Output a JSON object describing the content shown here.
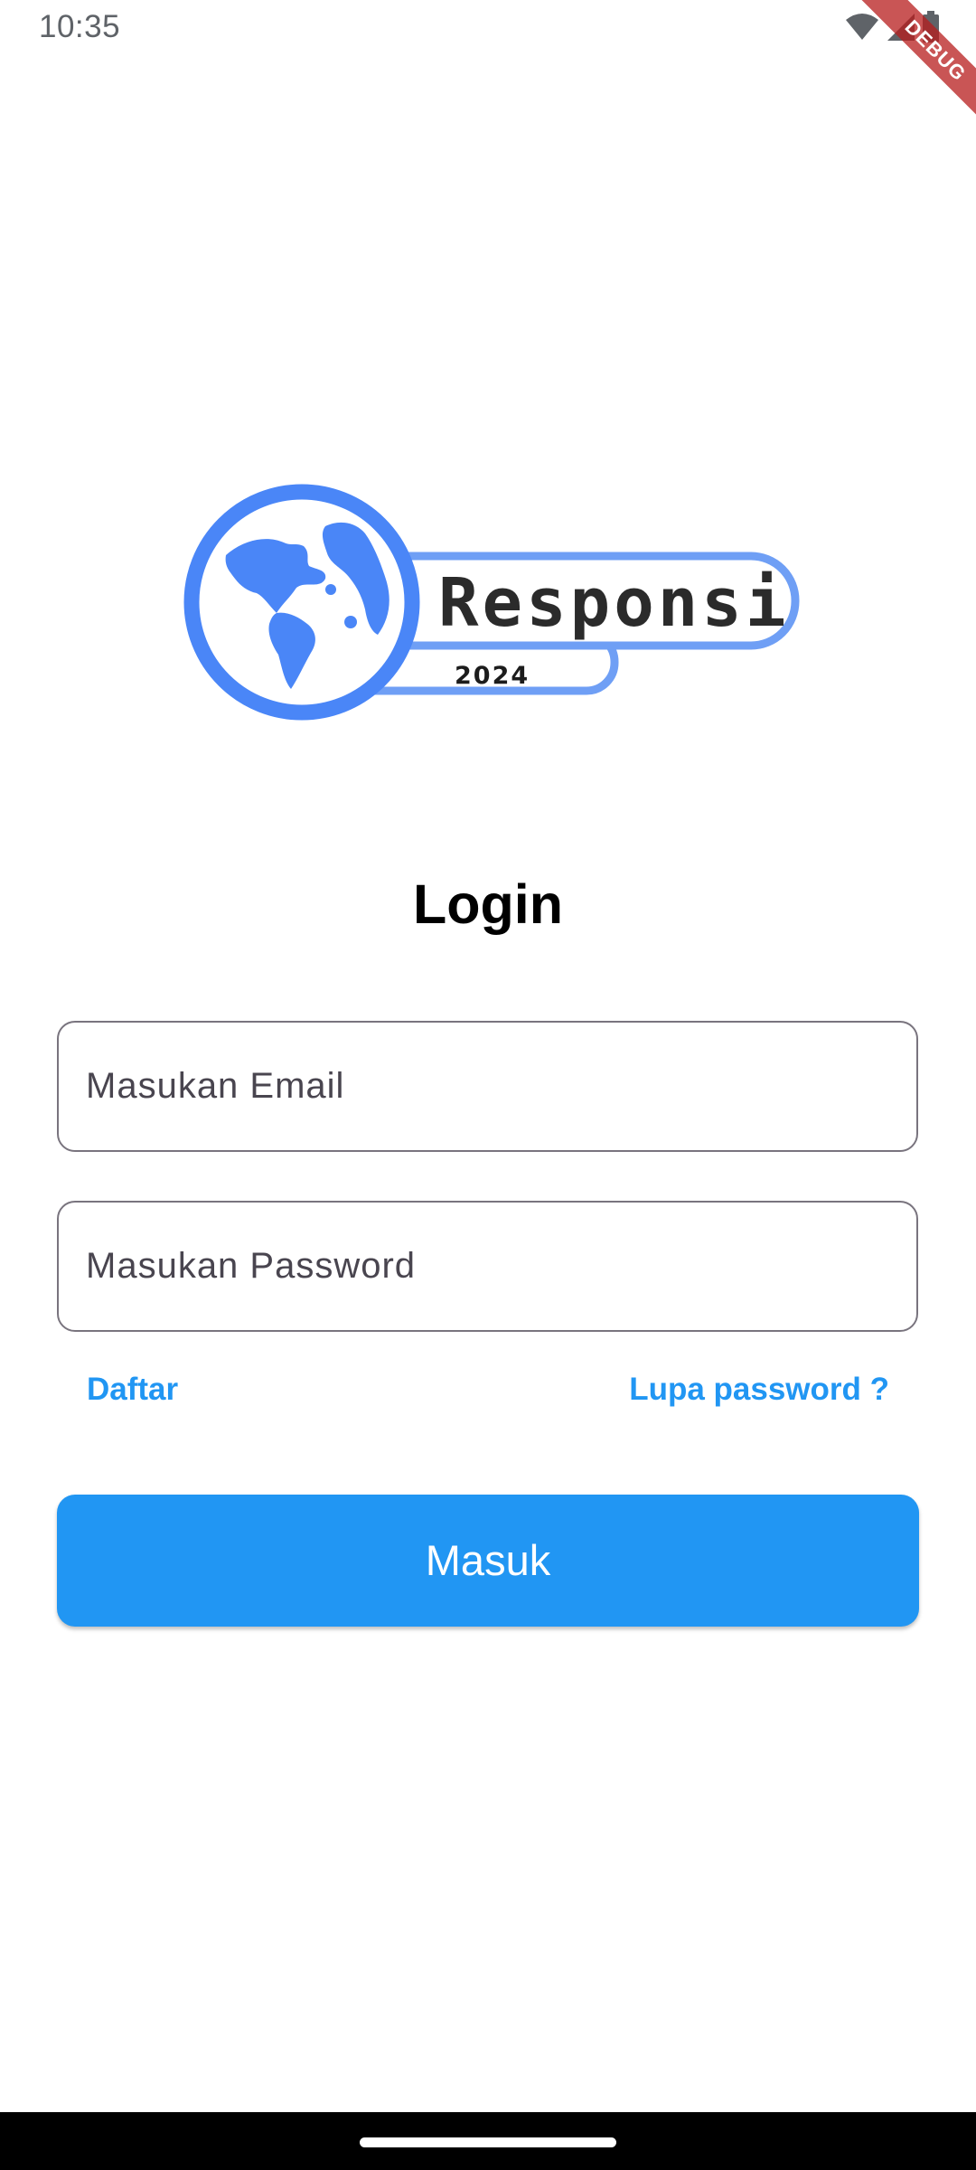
{
  "status_bar": {
    "time": "10:35",
    "icons": [
      "wifi-icon",
      "cellular-signal-icon",
      "battery-icon"
    ]
  },
  "debug_banner": {
    "label": "DEBUG"
  },
  "logo": {
    "brand": "Responsi",
    "year": "2024",
    "colors": {
      "primary": "#4a86f7",
      "light": "#6f9ff5",
      "text": "#2b2b2b"
    }
  },
  "login": {
    "title": "Login",
    "email_placeholder": "Masukan Email",
    "password_placeholder": "Masukan Password",
    "register_label": "Daftar",
    "forgot_label": "Lupa password ?",
    "submit_label": "Masuk"
  },
  "colors": {
    "accent": "#2196f3",
    "field_border": "#79747e",
    "nav_bar": "#000000"
  }
}
